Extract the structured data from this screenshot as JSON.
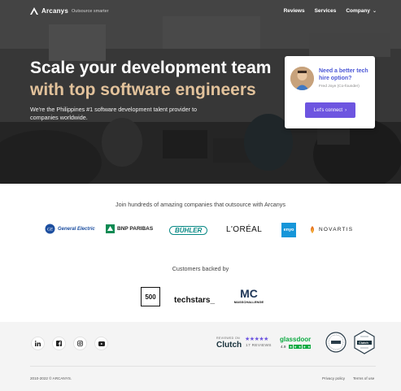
{
  "nav": {
    "brand": "Arcanys",
    "tagline": "Outsource smarter",
    "links": [
      "Reviews",
      "Services",
      "Company"
    ]
  },
  "hero": {
    "title_line1": "Scale your development team",
    "title_line2": "with top software engineers",
    "subtitle": "We're the Philippines #1 software development talent provider to companies worldwide."
  },
  "contact_card": {
    "title": "Need a better tech hire option?",
    "person": "Fred Joye (Co-founder)",
    "button": "Let's connect"
  },
  "partners": {
    "heading": "Join hundreds of amazing companies that outsource with Arcanys",
    "logos": [
      "General Electric",
      "BNP PARIBAS",
      "BÜHLER",
      "L'ORÉAL",
      "enyo",
      "NOVARTIS"
    ]
  },
  "backers": {
    "heading": "Customers backed by",
    "logos": [
      "500",
      "techstars_",
      "MC",
      "MASSCHALLENGE"
    ]
  },
  "footer": {
    "social": [
      "linkedin-icon",
      "facebook-icon",
      "instagram-icon",
      "youtube-icon"
    ],
    "clutch": {
      "kicker": "REVIEWED ON",
      "name": "Clutch",
      "reviews": "17 REVIEWS",
      "stars": 5
    },
    "glassdoor": {
      "name": "glassdoor",
      "rating": "4.9",
      "stars": 5
    },
    "badge_clutch": "Clutch",
    "copyright": "2010-2022 © ARCANYS.",
    "links": [
      "Privacy policy",
      "Terms of use"
    ]
  },
  "colors": {
    "accent": "#6d55e0",
    "gold": "#e2c29b",
    "link_blue": "#4b57d6",
    "clutch_star": "#6d55e0",
    "glassdoor_green": "#0caa41"
  }
}
